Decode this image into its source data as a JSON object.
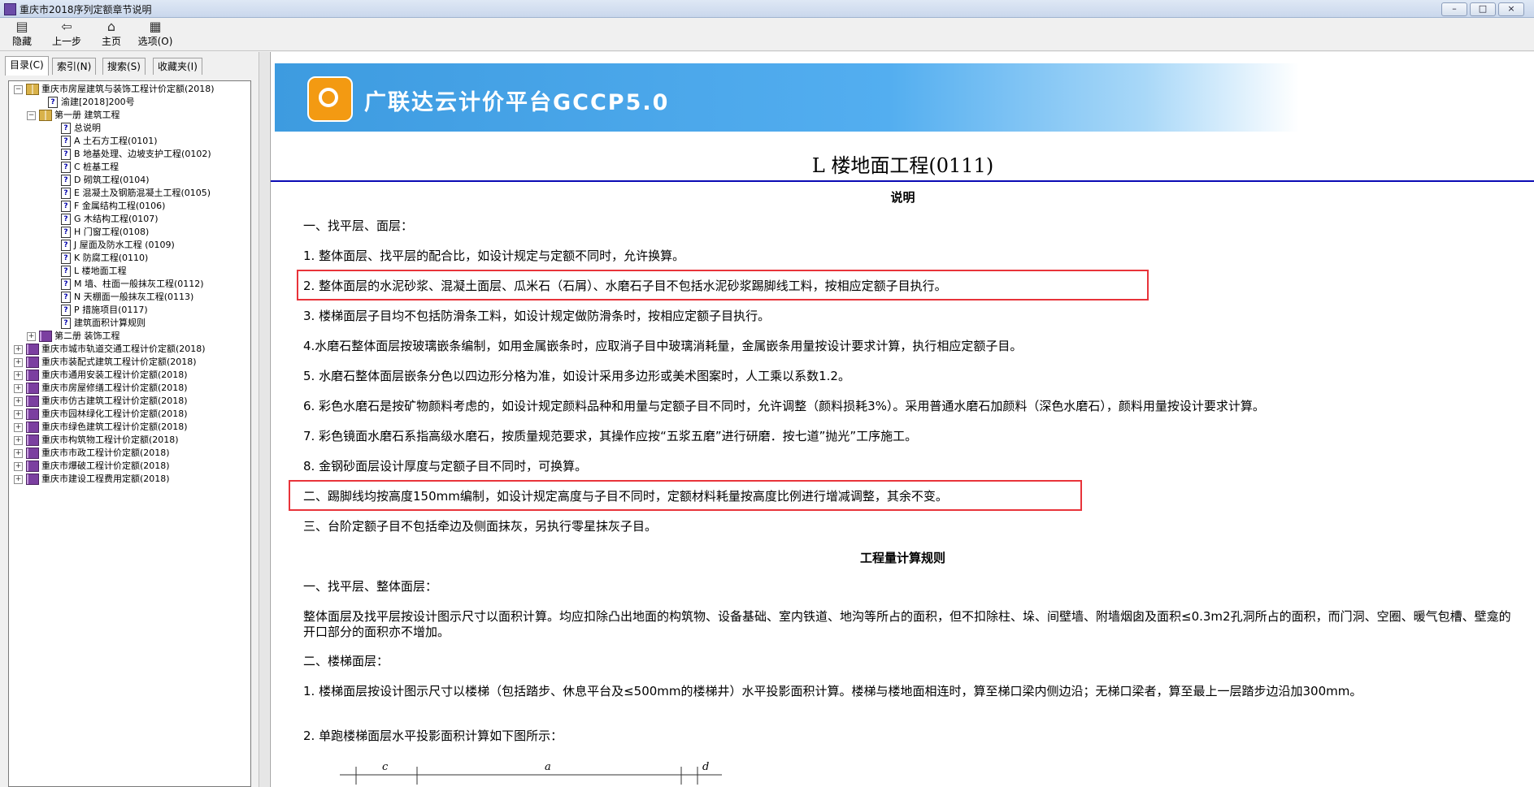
{
  "window": {
    "title": "重庆市2018序列定额章节说明",
    "buttons": [
      "–",
      "□",
      "×"
    ]
  },
  "toolbar": {
    "items": [
      {
        "label": "隐藏",
        "icon": "hide-icon"
      },
      {
        "label": "上一步",
        "icon": "back-icon"
      },
      {
        "label": "主页",
        "icon": "home-icon"
      },
      {
        "label": "选项(O)",
        "icon": "options-icon"
      }
    ]
  },
  "nav_tabs": [
    "目录(C)",
    "索引(N)",
    "搜索(S)",
    "收藏夹(I)"
  ],
  "tree": [
    {
      "text": "重庆市房屋建筑与装饰工程计价定额(2018)",
      "level": 0,
      "type": "book-open",
      "toggle": "−"
    },
    {
      "text": "渝建[2018]200号",
      "level": 1,
      "type": "page"
    },
    {
      "text": "第一册 建筑工程",
      "level": 1,
      "type": "book-open",
      "toggle": "−"
    },
    {
      "text": "总说明",
      "level": 2,
      "type": "page"
    },
    {
      "text": "A 土石方工程(0101)",
      "level": 2,
      "type": "page"
    },
    {
      "text": "B 地基处理、边坡支护工程(0102)",
      "level": 2,
      "type": "page"
    },
    {
      "text": "C 桩基工程",
      "level": 2,
      "type": "page"
    },
    {
      "text": "D 砌筑工程(0104)",
      "level": 2,
      "type": "page"
    },
    {
      "text": "E 混凝土及钢筋混凝土工程(0105)",
      "level": 2,
      "type": "page"
    },
    {
      "text": "F 金属结构工程(0106)",
      "level": 2,
      "type": "page"
    },
    {
      "text": "G 木结构工程(0107)",
      "level": 2,
      "type": "page"
    },
    {
      "text": "H 门窗工程(0108)",
      "level": 2,
      "type": "page"
    },
    {
      "text": "J 屋面及防水工程 (0109)",
      "level": 2,
      "type": "page"
    },
    {
      "text": "K 防腐工程(0110)",
      "level": 2,
      "type": "page"
    },
    {
      "text": "L 楼地面工程",
      "level": 2,
      "type": "page"
    },
    {
      "text": "M 墙、柱面一般抹灰工程(0112)",
      "level": 2,
      "type": "page"
    },
    {
      "text": "N 天棚面一般抹灰工程(0113)",
      "level": 2,
      "type": "page"
    },
    {
      "text": "P 措施项目(0117)",
      "level": 2,
      "type": "page"
    },
    {
      "text": "建筑面积计算规则",
      "level": 2,
      "type": "page"
    },
    {
      "text": "第二册 装饰工程",
      "level": 1,
      "type": "book-closed",
      "toggle": "+"
    },
    {
      "text": "重庆市城市轨道交通工程计价定额(2018)",
      "level": 0,
      "type": "book-closed",
      "toggle": "+"
    },
    {
      "text": "重庆市装配式建筑工程计价定额(2018)",
      "level": 0,
      "type": "book-closed",
      "toggle": "+"
    },
    {
      "text": "重庆市通用安装工程计价定额(2018)",
      "level": 0,
      "type": "book-closed",
      "toggle": "+"
    },
    {
      "text": "重庆市房屋修缮工程计价定额(2018)",
      "level": 0,
      "type": "book-closed",
      "toggle": "+"
    },
    {
      "text": "重庆市仿古建筑工程计价定额(2018)",
      "level": 0,
      "type": "book-closed",
      "toggle": "+"
    },
    {
      "text": "重庆市园林绿化工程计价定额(2018)",
      "level": 0,
      "type": "book-closed",
      "toggle": "+"
    },
    {
      "text": "重庆市绿色建筑工程计价定额(2018)",
      "level": 0,
      "type": "book-closed",
      "toggle": "+"
    },
    {
      "text": "重庆市构筑物工程计价定额(2018)",
      "level": 0,
      "type": "book-closed",
      "toggle": "+"
    },
    {
      "text": "重庆市市政工程计价定额(2018)",
      "level": 0,
      "type": "book-closed",
      "toggle": "+"
    },
    {
      "text": "重庆市爆破工程计价定额(2018)",
      "level": 0,
      "type": "book-closed",
      "toggle": "+"
    },
    {
      "text": "重庆市建设工程费用定额(2018)",
      "level": 0,
      "type": "book-closed",
      "toggle": "+"
    }
  ],
  "banner": {
    "title": "广联达云计价平台GCCP5.0"
  },
  "document": {
    "title": "L 楼地面工程(0111)",
    "section1_heading": "说明",
    "section2_heading": "工程量计算规则",
    "paragraphs": [
      "一、找平层、面层：",
      "1. 整体面层、找平层的配合比，如设计规定与定额不同时，允许换算。",
      "2. 整体面层的水泥砂浆、混凝土面层、瓜米石（石屑）、水磨石子目不包括水泥砂浆踢脚线工料，按相应定额子目执行。",
      "3. 楼梯面层子目均不包括防滑条工料，如设计规定做防滑条时，按相应定额子目执行。",
      "4.水磨石整体面层按玻璃嵌条编制，如用金属嵌条时，应取消子目中玻璃消耗量，金属嵌条用量按设计要求计算，执行相应定额子目。",
      "5. 水磨石整体面层嵌条分色以四边形分格为准，如设计采用多边形或美术图案时，人工乘以系数1.2。",
      "6. 彩色水磨石是按矿物颜料考虑的，如设计规定颜料品种和用量与定额子目不同时，允许调整（颜料损耗3%）。采用普通水磨石加颜料（深色水磨石），颜料用量按设计要求计算。",
      "7. 彩色镜面水磨石系指高级水磨石，按质量规范要求，其操作应按“五浆五磨”进行研磨．按七道”抛光”工序施工。",
      "8. 金钢砂面层设计厚度与定额子目不同时，可换算。",
      "二、踢脚线均按高度150mm编制，如设计规定高度与子目不同时，定额材料耗量按高度比例进行增减调整，其余不变。",
      "三、台阶定额子目不包括牵边及侧面抹灰，另执行零星抹灰子目。"
    ],
    "rules": [
      "一、找平层、整体面层：",
      "整体面层及找平层按设计图示尺寸以面积计算。均应扣除凸出地面的构筑物、设备基础、室内铁道、地沟等所占的面积，但不扣除柱、垛、间壁墙、附墙烟囱及面积≤0.3m2孔洞所占的面积，而门洞、空圈、暖气包槽、壁龛的开口部分的面积亦不增加。",
      "二、楼梯面层：",
      "1. 楼梯面层按设计图示尺寸以楼梯（包括踏步、休息平台及≤500mm的楼梯井）水平投影面积计算。楼梯与楼地面相连时，算至梯口梁内侧边沿；无梯口梁者，算至最上一层踏步边沿加300mm。",
      "2. 单跑楼梯面层水平投影面积计算如下图所示："
    ],
    "diagram_labels": [
      "c",
      "a",
      "d"
    ]
  },
  "colors": {
    "highlight": "#e8333a",
    "rule": "#0a0ab4",
    "banner": "#3d9be0",
    "logo": "#f39a12"
  }
}
